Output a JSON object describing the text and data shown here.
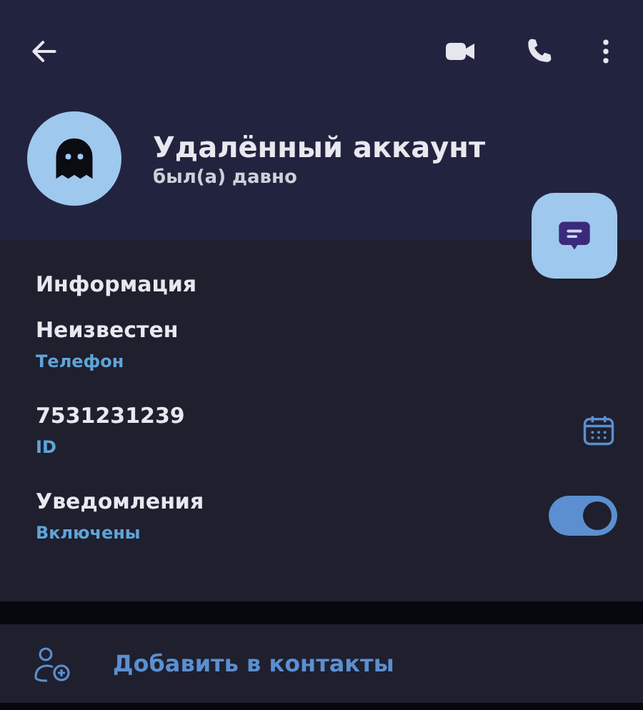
{
  "profile": {
    "name": "Удалённый аккаунт",
    "status": "был(а) давно"
  },
  "info": {
    "title": "Информация",
    "rows": [
      {
        "kind": "plain",
        "value": "Неизвестен",
        "label": "Телефон"
      },
      {
        "kind": "calendar",
        "value": "7531231239",
        "label": "ID"
      },
      {
        "kind": "toggle",
        "value": "Уведомления",
        "label": "Включены",
        "on": true
      }
    ]
  },
  "add_contact": {
    "label": "Добавить в контакты"
  }
}
